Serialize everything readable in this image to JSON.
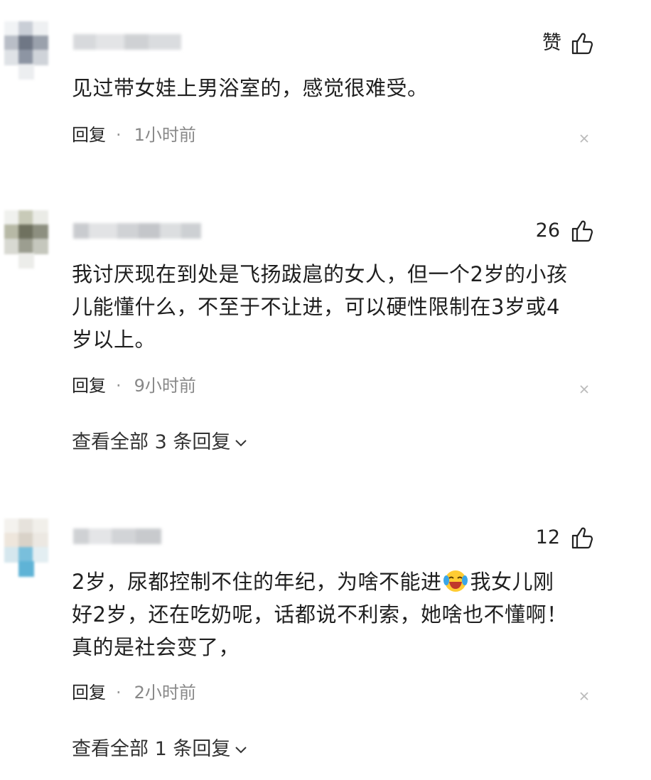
{
  "comments": [
    {
      "likes": "赞",
      "text": "见过带女娃上男浴室的，感觉很难受。",
      "reply_label": "回复",
      "separator": "·",
      "time": "1小时前"
    },
    {
      "likes": "26",
      "text_lines": [
        "我讨厌现在到处是飞扬跋扈的女人，但一个2岁的小孩",
        "儿能懂什么，不至于不让进，可以硬性限制在3岁或4",
        "岁以上。"
      ],
      "reply_label": "回复",
      "separator": "·",
      "time": "9小时前",
      "view_all": "查看全部 3 条回复"
    },
    {
      "likes": "12",
      "text_line1_a": "2岁，尿都控制不住的年纪，为啥不能进",
      "text_line1_b": "我女儿刚",
      "text_lines": [
        "好2岁，还在吃奶呢，话都说不利索，她啥也不懂啊！",
        "真的是社会变了，"
      ],
      "reply_label": "回复",
      "separator": "·",
      "time": "2小时前",
      "view_all": "查看全部 1 条回复"
    }
  ],
  "icons": {
    "like": "thumbs-up-icon",
    "close": "close-icon",
    "chevron": "chevron-down-icon",
    "emoji": "laughing-crying-emoji"
  },
  "colors": {
    "text": "#1f1f1f",
    "meta": "#888888",
    "close": "#bbbbbb"
  }
}
